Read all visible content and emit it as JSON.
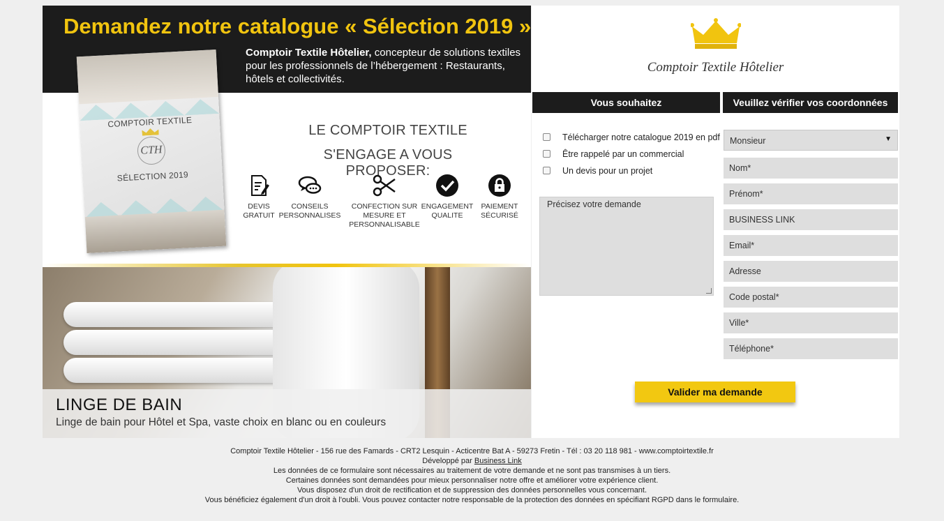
{
  "hero": {
    "title": "Demandez notre catalogue « Sélection 2019 »",
    "brand_bold": "Comptoir Textile Hôtelier,",
    "description": " concepteur de solutions textiles pour les professionnels de l’hébergement : Restaurants, hôtels et collectivités."
  },
  "brochure": {
    "line1": "COMPTOIR TEXTILE",
    "monogram": "CTH",
    "line2": "SÉLECTION 2019"
  },
  "engage": {
    "title_line1": "LE COMPTOIR TEXTILE",
    "title_line2": "S'ENGAGE A VOUS PROPOSER:"
  },
  "features": [
    {
      "label_line1": "DEVIS",
      "label_line2": "GRATUIT",
      "label_line3": "",
      "icon": "document-pen-icon"
    },
    {
      "label_line1": "CONSEILS",
      "label_line2": "PERSONNALISES",
      "label_line3": "",
      "icon": "chat-bubbles-icon"
    },
    {
      "label_line1": "CONFECTION SUR",
      "label_line2": "MESURE ET",
      "label_line3": "PERSONNALISABLE",
      "icon": "scissors-icon"
    },
    {
      "label_line1": "ENGAGEMENT",
      "label_line2": "QUALITE",
      "label_line3": "",
      "icon": "check-circle-icon"
    },
    {
      "label_line1": "PAIEMENT",
      "label_line2": "SÉCURISÉ",
      "label_line3": "",
      "icon": "lock-circle-icon"
    }
  ],
  "banner": {
    "title": "LINGE DE BAIN",
    "subtitle": "Linge de bain pour Hôtel et Spa, vaste choix en blanc ou en couleurs"
  },
  "logo": {
    "brand": "Comptoir Textile Hôtelier"
  },
  "form": {
    "col1_heading": "Vous souhaitez",
    "col2_heading": "Veuillez vérifier vos coordonnées",
    "options": [
      "Télécharger notre catalogue 2019 en pdf",
      "Être rappelé par un commercial",
      "Un devis pour un projet"
    ],
    "textarea_placeholder": "Précisez votre demande",
    "civility_value": "Monsieur",
    "fields": [
      "Nom*",
      "Prénom*",
      "BUSINESS LINK",
      "Email*",
      "Adresse",
      "Code postal*",
      "Ville*",
      "Téléphone*"
    ],
    "submit_label": "Valider ma demande"
  },
  "footer": {
    "address": "Comptoir Textile Hôtelier - 156 rue des Famards - CRT2 Lesquin - Acticentre Bat A - 59273 Fretin - Tél : 03 20 118 981 - www.comptoirtextile.fr",
    "developed_prefix": "Développé par ",
    "developed_link": "Business Link",
    "line3": "Les données de ce formulaire sont nécessaires au traitement de votre demande et ne sont pas transmises à un tiers.",
    "line4": "Certaines données sont demandées pour mieux personnaliser notre offre et améliorer votre expérience client.",
    "line5": "Vous disposez d'un droit de rectification et de suppression des données personnelles vous concernant.",
    "line6": "Vous bénéficiez également d'un droit à l'oubli. Vous pouvez contacter notre responsable de la protection des données en spécifiant RGPD dans le formulaire."
  },
  "colors": {
    "accent_yellow": "#f1c40f",
    "header_black": "#1c1c1c",
    "field_gray": "#dedede",
    "page_bg": "#efefef"
  }
}
